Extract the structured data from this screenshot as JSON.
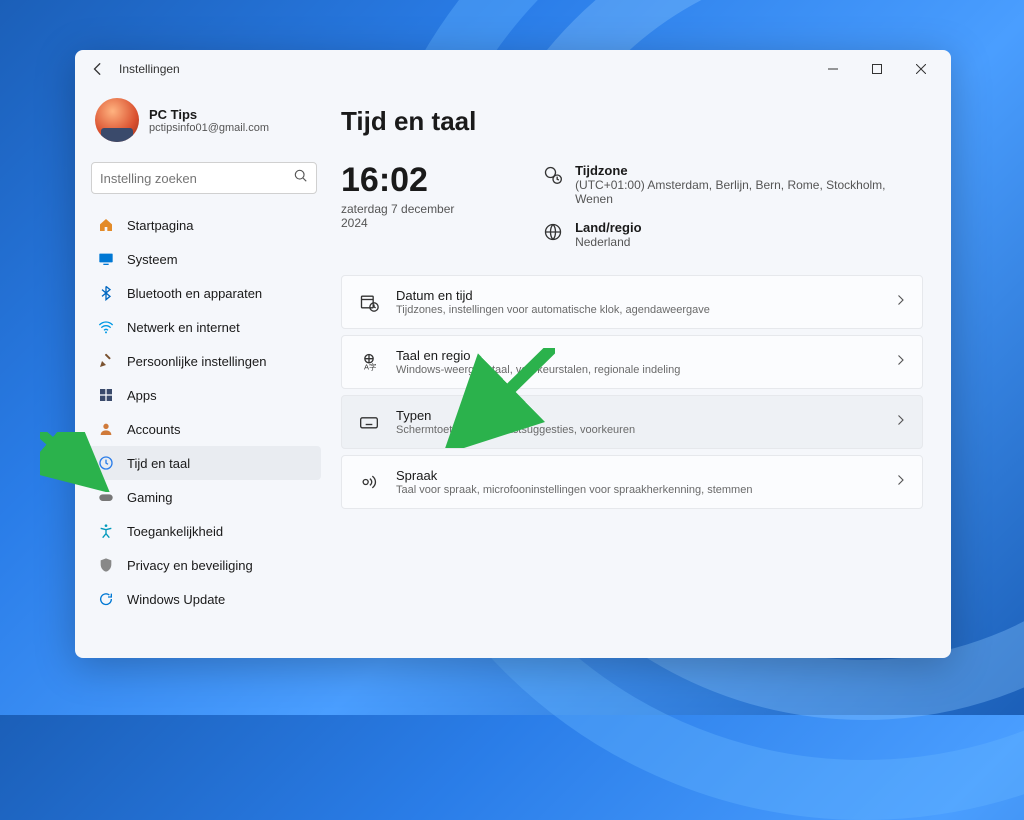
{
  "window": {
    "title": "Instellingen"
  },
  "profile": {
    "name": "PC Tips",
    "email": "pctipsinfo01@gmail.com"
  },
  "search": {
    "placeholder": "Instelling zoeken"
  },
  "sidebar": {
    "items": [
      {
        "label": "Startpagina",
        "icon": "home-icon",
        "color": "#e38b29"
      },
      {
        "label": "Systeem",
        "icon": "system-icon",
        "color": "#0078d4"
      },
      {
        "label": "Bluetooth en apparaten",
        "icon": "bluetooth-icon",
        "color": "#0067c0"
      },
      {
        "label": "Netwerk en internet",
        "icon": "network-icon",
        "color": "#0099e5"
      },
      {
        "label": "Persoonlijke instellingen",
        "icon": "personalize-icon",
        "color": "#7a5230"
      },
      {
        "label": "Apps",
        "icon": "apps-icon",
        "color": "#3a4a6b"
      },
      {
        "label": "Accounts",
        "icon": "accounts-icon",
        "color": "#d07a3a"
      },
      {
        "label": "Tijd en taal",
        "icon": "time-icon",
        "color": "#2b7de9",
        "selected": true
      },
      {
        "label": "Gaming",
        "icon": "gaming-icon",
        "color": "#777"
      },
      {
        "label": "Toegankelijkheid",
        "icon": "accessibility-icon",
        "color": "#0099bc"
      },
      {
        "label": "Privacy en beveiliging",
        "icon": "privacy-icon",
        "color": "#888"
      },
      {
        "label": "Windows Update",
        "icon": "update-icon",
        "color": "#0078d4"
      }
    ]
  },
  "main": {
    "heading": "Tijd en taal",
    "clock": {
      "time": "16:02",
      "date": "zaterdag 7 december 2024"
    },
    "timezone": {
      "label": "Tijdzone",
      "value": "(UTC+01:00) Amsterdam, Berlijn, Bern, Rome, Stockholm, Wenen"
    },
    "region": {
      "label": "Land/regio",
      "value": "Nederland"
    },
    "cards": [
      {
        "title": "Datum en tijd",
        "desc": "Tijdzones, instellingen voor automatische klok, agendaweergave",
        "icon": "calendar-clock-icon"
      },
      {
        "title": "Taal en regio",
        "desc": "Windows-weergavetaal, voorkeurstalen, regionale indeling",
        "icon": "language-region-icon"
      },
      {
        "title": "Typen",
        "desc": "Schermtoetsenbord, tekstsuggesties, voorkeuren",
        "icon": "keyboard-icon",
        "highlight": true
      },
      {
        "title": "Spraak",
        "desc": "Taal voor spraak, microfooninstellingen voor spraakherkenning, stemmen",
        "icon": "speech-icon"
      }
    ]
  }
}
